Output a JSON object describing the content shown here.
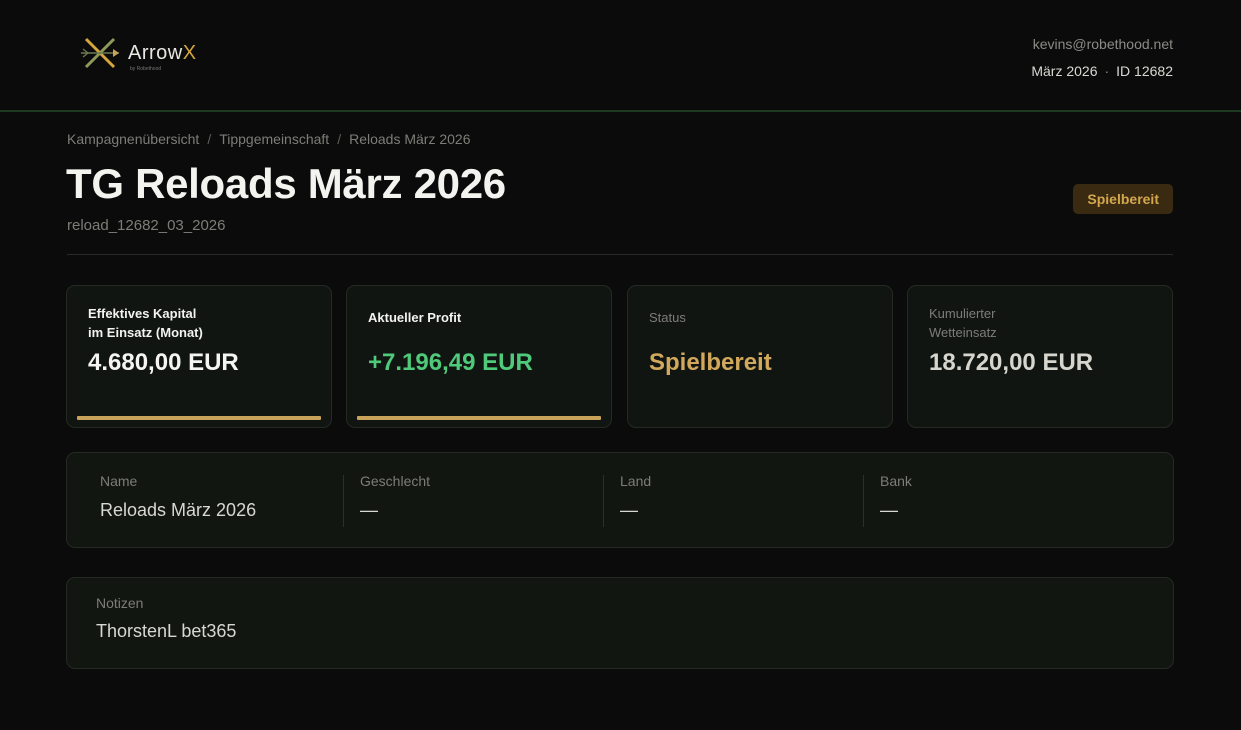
{
  "header": {
    "logo_word": "Arrow",
    "logo_x": "X",
    "logo_sub": "by Robethood",
    "user_email": "kevins@robethood.net",
    "period": "März 2026",
    "separator": "·",
    "user_id": "ID 12682"
  },
  "breadcrumb": {
    "items": [
      "Kampagnenübersicht",
      "Tippgemeinschaft",
      "Reloads März 2026"
    ],
    "separator": "/"
  },
  "page": {
    "title": "TG Reloads März 2026",
    "subtitle": "reload_12682_03_2026",
    "status_badge": "Spielbereit"
  },
  "cards": [
    {
      "label_line1": "Effektives Kapital",
      "label_line2": "im Einsatz (Monat)",
      "value": "4.680,00 EUR",
      "value_color": "#f4f4f0",
      "has_bar": true
    },
    {
      "label_line1": "Aktueller Profit",
      "label_line2": "",
      "value": "+7.196,49 EUR",
      "value_color": "#4fc97a",
      "has_bar": true
    },
    {
      "label_line1": "Status",
      "label_line2": "",
      "value": "Spielbereit",
      "value_color": "#d2a85c",
      "has_bar": false
    },
    {
      "label_line1": "Kumulierter",
      "label_line2": "Wetteinsatz",
      "value": "18.720,00 EUR",
      "value_color": "#d6d6cf",
      "has_bar": false
    }
  ],
  "info": {
    "name_label": "Name",
    "name_value": "Reloads März 2026",
    "gender_label": "Geschlecht",
    "gender_value": "—",
    "country_label": "Land",
    "country_value": "—",
    "bank_label": "Bank",
    "bank_value": "—"
  },
  "notes": {
    "label": "Notizen",
    "value": "ThorstenL bet365"
  },
  "colors": {
    "accent_gold": "#d4a63b",
    "profit_green": "#4fc97a",
    "header_rule": "#1d3a20"
  }
}
